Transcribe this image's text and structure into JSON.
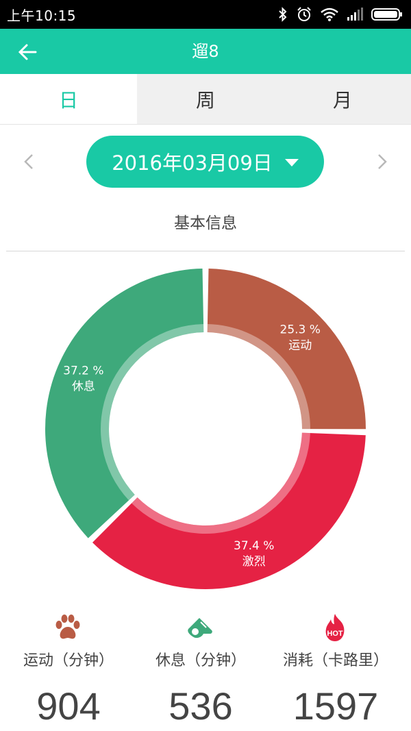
{
  "status_bar": {
    "time": "上午10:15",
    "icons": [
      "bluetooth-icon",
      "alarm-icon",
      "wifi-icon",
      "signal-icon",
      "battery-icon"
    ]
  },
  "app_bar": {
    "title": "遛8",
    "back_icon": "arrow-left-icon"
  },
  "tabs": [
    {
      "label": "日",
      "active": true
    },
    {
      "label": "周",
      "active": false
    },
    {
      "label": "月",
      "active": false
    }
  ],
  "date_selector": {
    "date": "2016年03月09日",
    "prev_icon": "chevron-left-icon",
    "next_icon": "chevron-right-icon",
    "dropdown_icon": "caret-down-icon"
  },
  "section": {
    "title": "基本信息"
  },
  "colors": {
    "accent": "#19c9a5",
    "exercise": "#b95c45",
    "intense": "#e52244",
    "rest": "#3ea97b"
  },
  "chart_data": {
    "type": "pie",
    "slices": [
      {
        "label": "运动",
        "percent_text": "25.3 %",
        "value": 25.3,
        "color": "#b95c45"
      },
      {
        "label": "激烈",
        "percent_text": "37.4 %",
        "value": 37.4,
        "color": "#e52244"
      },
      {
        "label": "休息",
        "percent_text": "37.2 %",
        "value": 37.2,
        "color": "#3ea97b"
      }
    ]
  },
  "stats": [
    {
      "icon": "paw-icon",
      "label": "运动（分钟）",
      "value": "904"
    },
    {
      "icon": "whistle-icon",
      "label": "休息（分钟）",
      "value": "536"
    },
    {
      "icon": "hot-flame-icon",
      "label": "消耗（卡路里）",
      "value": "1597"
    }
  ]
}
